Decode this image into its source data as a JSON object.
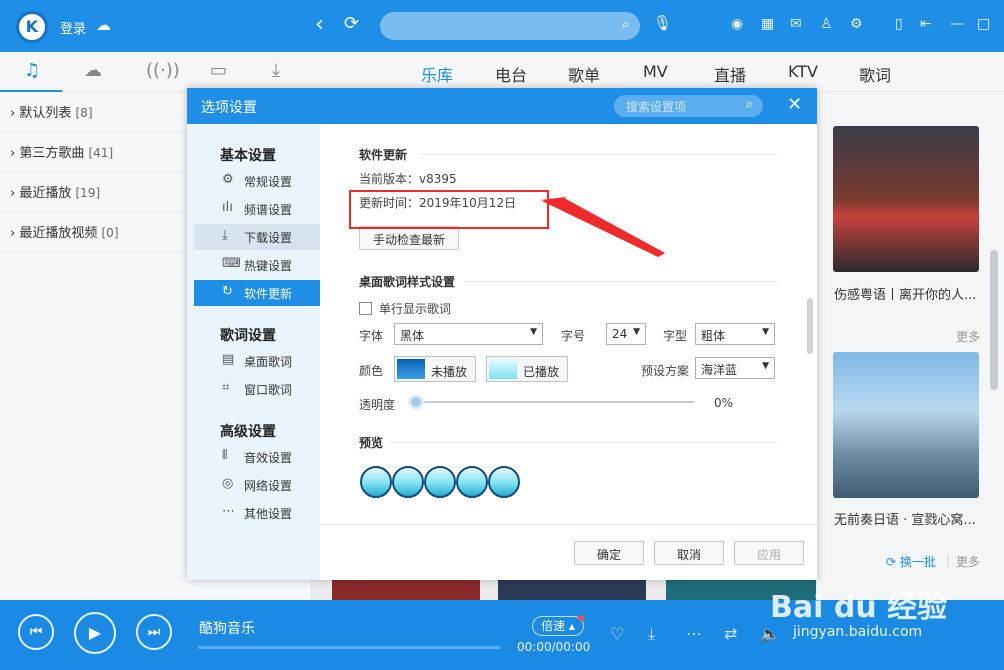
{
  "topbar": {
    "logo_letter": "K",
    "login": "登录",
    "icons": [
      "cloud-icon",
      "back-icon",
      "refresh-icon",
      "search-icon",
      "mic-icon",
      "radio-icon",
      "apps-icon",
      "mail-icon",
      "shirt-icon",
      "settings-icon",
      "mini-icon",
      "exit-icon",
      "minimize-icon",
      "maximize-icon",
      "close-icon"
    ]
  },
  "left_tabs": [
    "music-note-icon",
    "cloud-icon",
    "radio-tower-icon",
    "device-icon",
    "download-icon"
  ],
  "main_tabs": [
    {
      "label": "乐库",
      "active": true
    },
    {
      "label": "电台"
    },
    {
      "label": "歌单"
    },
    {
      "label": "MV"
    },
    {
      "label": "直播"
    },
    {
      "label": "KTV"
    },
    {
      "label": "歌词"
    }
  ],
  "sidebar": {
    "items": [
      {
        "label": "默认列表",
        "count": "[8]"
      },
      {
        "label": "第三方歌曲",
        "count": "[41]"
      },
      {
        "label": "最近播放",
        "count": "[19]"
      },
      {
        "label": "最近播放视频",
        "count": "[0]"
      }
    ]
  },
  "right_cards": {
    "items": [
      {
        "caption": "伤感粤语丨离开你的人..."
      },
      {
        "caption": "无前奏日语 · 宣戮心窝..."
      }
    ],
    "more1": "更多",
    "refresh": "换一批",
    "divider": "|",
    "more2": "更多"
  },
  "dialog": {
    "title": "选项设置",
    "search_placeholder": "搜索设置项",
    "side": {
      "groups": [
        {
          "title": "基本设置",
          "items": [
            {
              "label": "常规设置",
              "icon": "gear-icon"
            },
            {
              "label": "频谱设置",
              "icon": "spectrum-icon"
            },
            {
              "label": "下载设置",
              "icon": "download-icon",
              "hover": true
            },
            {
              "label": "热键设置",
              "icon": "keyboard-icon"
            },
            {
              "label": "软件更新",
              "icon": "update-icon",
              "active": true
            }
          ]
        },
        {
          "title": "歌词设置",
          "items": [
            {
              "label": "桌面歌词",
              "icon": "desktop-lyric-icon"
            },
            {
              "label": "窗口歌词",
              "icon": "window-lyric-icon"
            }
          ]
        },
        {
          "title": "高级设置",
          "items": [
            {
              "label": "音效设置",
              "icon": "equalizer-icon"
            },
            {
              "label": "网络设置",
              "icon": "network-icon"
            },
            {
              "label": "其他设置",
              "icon": "more-icon"
            }
          ]
        }
      ]
    },
    "update": {
      "section": "软件更新",
      "version": "当前版本：v8395",
      "update_time": "更新时间：2019年10月12日",
      "check_button": "手动检查最新"
    },
    "lyric": {
      "section": "桌面歌词样式设置",
      "single_line": "单行显示歌词",
      "font_label": "字体",
      "font_value": "黑体",
      "size_label": "字号",
      "size_value": "24",
      "style_label": "字型",
      "style_value": "粗体",
      "color_label": "颜色",
      "unplayed": "未播放",
      "played": "已播放",
      "preset_label": "预设方案",
      "preset_value": "海洋蓝",
      "opacity_label": "透明度",
      "opacity_value": "0%",
      "unplayed_color": "#0a5fb4",
      "played_color": "#7fe1f1"
    },
    "preview": {
      "section": "预览"
    },
    "buttons": {
      "ok": "确定",
      "cancel": "取消",
      "apply": "应用"
    }
  },
  "player": {
    "title": "酷狗音乐",
    "speed": "倍速",
    "time": "00:00/00:00",
    "icons": [
      "prev-icon",
      "play-icon",
      "next-icon",
      "heart-icon",
      "download-icon",
      "more-icon",
      "loop-icon",
      "volume-icon"
    ],
    "accent": "#1a8ae4"
  },
  "watermark": {
    "text": "Bai du 经验",
    "sub": "jingyan.baidu.com"
  }
}
